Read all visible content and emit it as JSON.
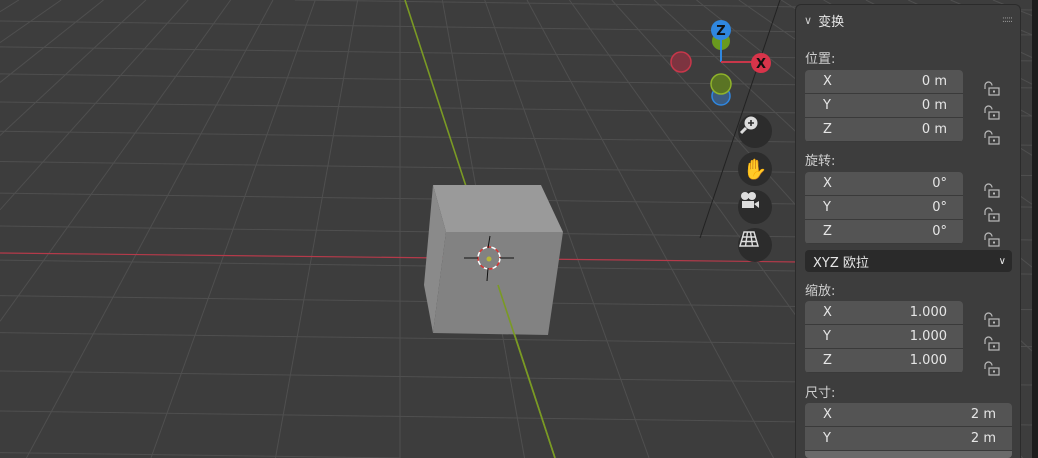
{
  "gizmo": {
    "z_label": "Z",
    "x_label": "X"
  },
  "nav_icons": [
    "zoom-icon",
    "hand-pan-icon",
    "camera-icon",
    "grid-perspective-icon"
  ],
  "panel": {
    "title": "变换",
    "location": {
      "label": "位置:",
      "x": "0 m",
      "y": "0 m",
      "z": "0 m"
    },
    "rotation": {
      "label": "旋转:",
      "x": "0°",
      "y": "0°",
      "z": "0°",
      "mode": "XYZ 欧拉"
    },
    "scale": {
      "label": "缩放:",
      "x": "1.000",
      "y": "1.000",
      "z": "1.000"
    },
    "dimensions": {
      "label": "尺寸:",
      "x": "2 m",
      "y": "2 m"
    },
    "axis": {
      "x": "X",
      "y": "Y",
      "z": "Z"
    }
  },
  "colors": {
    "x_axis": "#c8374a",
    "y_axis": "#7a9a24",
    "z_axis": "#2f87e0",
    "bg": "#3d3d3d"
  }
}
